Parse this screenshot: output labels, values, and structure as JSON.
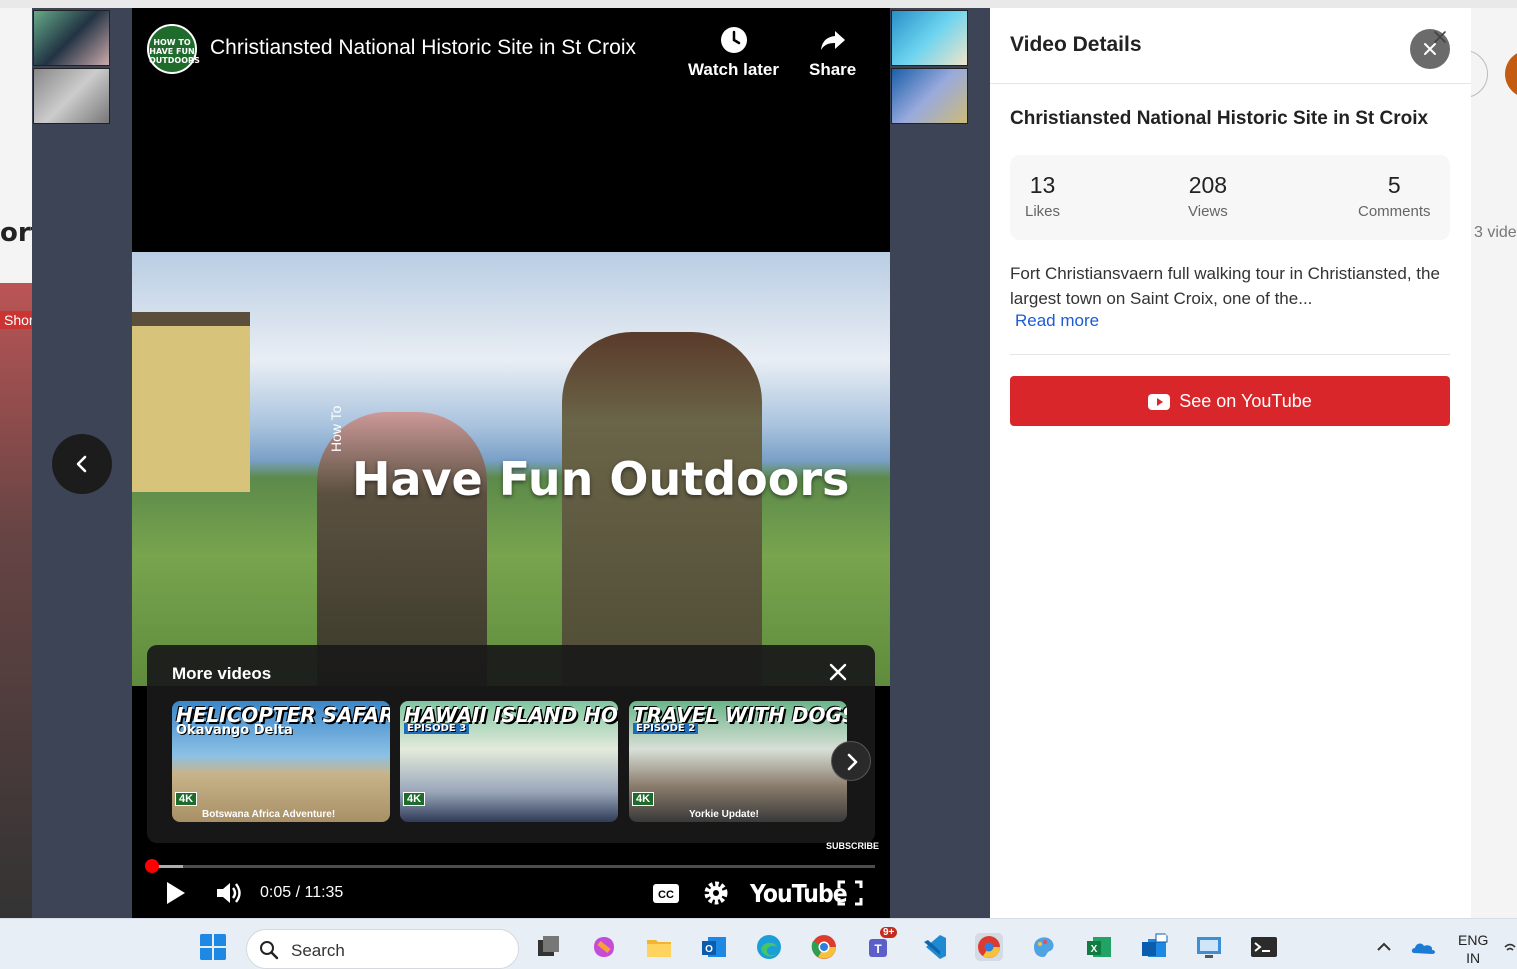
{
  "background": {
    "left_text": "ort",
    "left_tag": "Shor",
    "right_text": "3 vide"
  },
  "video": {
    "channel_logo_text": "HOW TO HAVE FUN OUTDOORS",
    "title": "Christiansted National Historic Site in St Croix",
    "watch_later_label": "Watch later",
    "share_label": "Share",
    "brand_overlay": "Have Fun Outdoors",
    "brand_overlay_small": "How To",
    "current_time": "0:05 / 11:35",
    "progress_fraction": 0.007,
    "buffered_fraction": 0.05,
    "youtube_logo": "YouTube",
    "subscribe_label": "SUBSCRIBE"
  },
  "more_videos": {
    "title": "More videos",
    "cards": [
      {
        "caption": "HELICOPTER SAFARI!",
        "subtitle": "Okavango Delta",
        "footer": "Botswana Africa Adventure!",
        "badge": "4K"
      },
      {
        "caption": "HAWAII ISLAND HOP CRUISE",
        "subtitle": "EPISODE 3",
        "footer": "",
        "badge": "4K"
      },
      {
        "caption": "TRAVEL WITH DOGS!",
        "subtitle": "EPISODE 2",
        "footer": "Yorkie Update!",
        "badge": "4K"
      }
    ]
  },
  "panel": {
    "title": "Video Details",
    "video_heading": "Christiansted National Historic Site in St Croix",
    "stats": {
      "likes_value": "13",
      "likes_label": "Likes",
      "views_value": "208",
      "views_label": "Views",
      "comments_value": "5",
      "comments_label": "Comments"
    },
    "description": "Fort Christiansvaern full walking tour in Christiansted, the largest town on Saint Croix, one of the...",
    "read_more": "Read more",
    "youtube_button": "See on YouTube"
  },
  "taskbar": {
    "search_placeholder": "Search",
    "teams_badge": "9+",
    "lang_line1": "ENG",
    "lang_line2": "IN"
  },
  "colors": {
    "accent_red": "#d9262a",
    "link_blue": "#1a5bd6",
    "progress_red": "#ff0000",
    "overlay_bg": "#3d4456"
  }
}
